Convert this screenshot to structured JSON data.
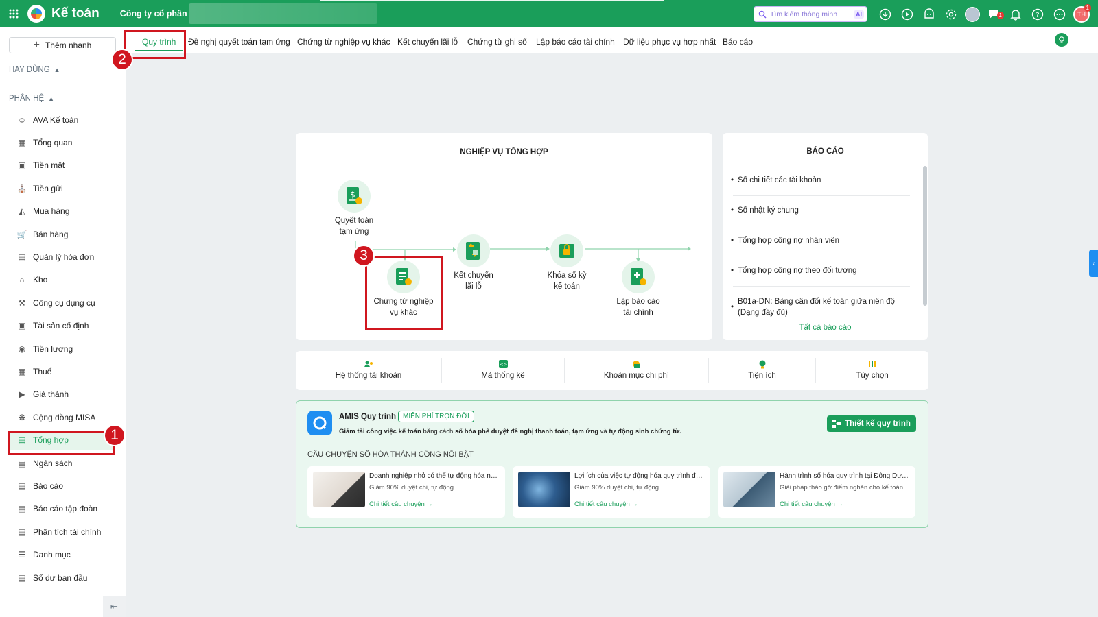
{
  "topbar": {
    "app_title": "Kế toán",
    "company": "Công ty cổ phần",
    "search_placeholder": "Tìm kiếm thông minh",
    "ai_label": "AI",
    "chat_badge": "1",
    "user_initials": "TH",
    "user_badge": "1",
    "brand_color": "#1a9e5a"
  },
  "sidebar": {
    "add_branch": "Thêm nhanh",
    "frequent_label": "HAY DÙNG",
    "modules_label": "PHÂN HỆ",
    "items": [
      {
        "label": "AVA Kế toán",
        "icon": "ava-avatar-icon"
      },
      {
        "label": "Tổng quan",
        "icon": "dashboard-icon"
      },
      {
        "label": "Tiền mặt",
        "icon": "cash-icon"
      },
      {
        "label": "Tiền gửi",
        "icon": "bank-icon"
      },
      {
        "label": "Mua hàng",
        "icon": "shopping-bag-icon"
      },
      {
        "label": "Bán hàng",
        "icon": "cart-icon"
      },
      {
        "label": "Quản lý hóa đơn",
        "icon": "invoice-icon"
      },
      {
        "label": "Kho",
        "icon": "warehouse-icon"
      },
      {
        "label": "Công cụ dụng cụ",
        "icon": "tools-icon"
      },
      {
        "label": "Tài sản cố định",
        "icon": "car-icon"
      },
      {
        "label": "Tiền lương",
        "icon": "salary-icon"
      },
      {
        "label": "Thuế",
        "icon": "tax-icon"
      },
      {
        "label": "Giá thành",
        "icon": "price-tag-icon"
      },
      {
        "label": "Cộng đồng MISA",
        "icon": "community-icon"
      },
      {
        "label": "Tổng hợp",
        "icon": "ledger-icon"
      },
      {
        "label": "Ngân sách",
        "icon": "budget-icon"
      },
      {
        "label": "Báo cáo",
        "icon": "bar-chart-icon"
      },
      {
        "label": "Báo cáo tập đoàn",
        "icon": "group-report-icon"
      },
      {
        "label": "Phân tích tài chính",
        "icon": "analysis-icon"
      },
      {
        "label": "Danh mục",
        "icon": "list-icon"
      },
      {
        "label": "Số dư ban đầu",
        "icon": "opening-balance-icon"
      }
    ],
    "active_index": 14
  },
  "tabs": [
    "Quy trình",
    "Đề nghị quyết toán tạm ứng",
    "Chứng từ nghiệp vụ khác",
    "Kết chuyển lãi lỗ",
    "Chứng từ ghi sổ",
    "Lập báo cáo tài chính",
    "Dữ liệu phục vụ hợp nhất",
    "Báo cáo"
  ],
  "workflow": {
    "title": "NGHIỆP VỤ TỔNG HỢP",
    "nodes": {
      "settle_advance": "Quyết toán tạm ứng",
      "other_vouchers": "Chứng từ nghiệp vụ khác",
      "transfer_pl": "Kết chuyển lãi lỗ",
      "lock_period": "Khóa sổ kỳ kế toán",
      "financial_report": "Lập báo cáo tài chính"
    }
  },
  "reports": {
    "title": "BÁO CÁO",
    "items": [
      "Sổ chi tiết các tài khoản",
      "Sổ nhật ký chung",
      "Tổng hợp công nợ nhân viên",
      "Tổng hợp công nợ theo đối tượng",
      "B01a-DN: Bảng cân đối kế toán giữa niên độ (Dạng đầy đủ)"
    ],
    "all_link": "Tất cả báo cáo"
  },
  "utilities": [
    {
      "label": "Hệ thống tài khoản",
      "icon": "account-system-icon"
    },
    {
      "label": "Mã thống kê",
      "icon": "stat-code-icon"
    },
    {
      "label": "Khoản mục chi phí",
      "icon": "cost-item-icon"
    },
    {
      "label": "Tiện ích",
      "icon": "utility-bulb-icon"
    },
    {
      "label": "Tùy chọn",
      "icon": "options-sliders-icon"
    }
  ],
  "promo": {
    "name": "AMIS Quy trình",
    "badge": "MIỄN PHÍ TRỌN ĐỜI",
    "desc_pre": "Giảm tải công việc kế toán",
    "desc_mid": " bằng cách ",
    "desc_bold": "số hóa phê duyệt đề nghị thanh toán, tạm ứng",
    "desc_mid2": " và ",
    "desc_bold2": "tự động sinh chứng từ.",
    "design_button": "Thiết kế quy trình",
    "stories_title": "CÂU CHUYỆN SỐ HÓA THÀNH CÔNG NỔI BẬT",
    "stories": [
      {
        "title": "Doanh nghiệp nhỏ có thể tự động hóa nhữ...",
        "desc": "Giảm 90% duyệt chi, tự động...",
        "link": "Chi tiết câu chuyện"
      },
      {
        "title": "Lợi ích của việc tự động hóa quy trình đối v...",
        "desc": "Giảm 90% duyệt chi, tự động...",
        "link": "Chi tiết câu chuyện"
      },
      {
        "title": "Hành trình số hóa quy trình tại Đông Dươn...",
        "desc": "Giải pháp tháo gỡ điểm nghẽn cho kế toán",
        "link": "Chi tiết câu chuyện"
      }
    ]
  },
  "annotations": {
    "step1": "1",
    "step2": "2",
    "step3": "3",
    "highlight_color": "#d0161f"
  }
}
